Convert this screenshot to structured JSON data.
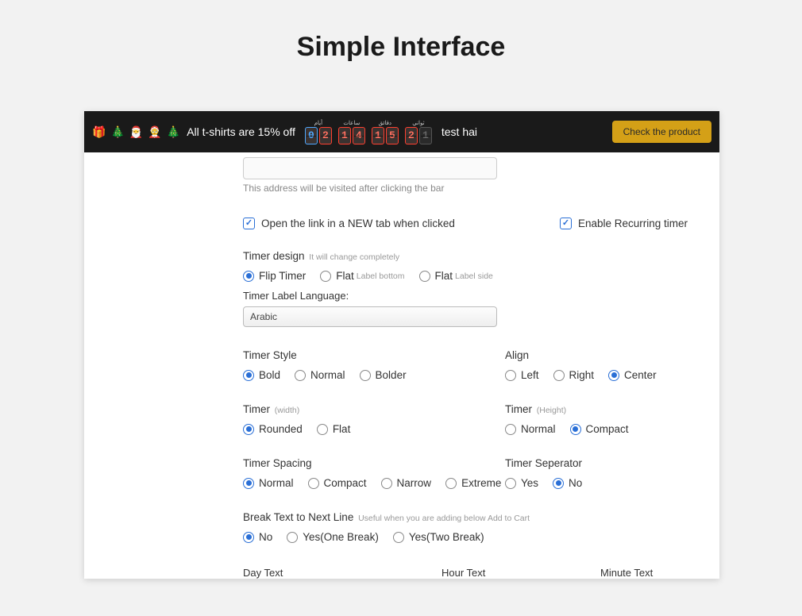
{
  "page": {
    "title": "Simple Interface"
  },
  "topbar": {
    "emojis": [
      "🎁",
      "🎄",
      "🎅",
      "🤶",
      "🎄"
    ],
    "promo_text": "All t-shirts are 15% off",
    "timer": {
      "days_lbl": "أيام",
      "hours_lbl": "ساعات",
      "mins_lbl": "دقائق",
      "secs_lbl": "ثواني",
      "d1": "0",
      "d2": "2",
      "h1": "1",
      "h2": "4",
      "m1": "1",
      "m2": "5",
      "s1": "2",
      "s2": "1"
    },
    "after_text": "test hai",
    "button": "Check the product"
  },
  "form": {
    "address_hint": "This address will be visited after clicking the bar",
    "open_new_tab_label": "Open the link in a NEW tab when clicked",
    "enable_recurring_label": "Enable Recurring timer",
    "timer_design": {
      "label": "Timer design",
      "sub": "It will change completely",
      "opt_flip": "Flip Timer",
      "opt_flat_bottom": "Flat",
      "opt_flat_bottom_sub": "Label bottom",
      "opt_flat_side": "Flat",
      "opt_flat_side_sub": "Label side"
    },
    "lang_label": "Timer Label Language:",
    "lang_value": "Arabic",
    "timer_style": {
      "label": "Timer Style",
      "opt1": "Bold",
      "opt2": "Normal",
      "opt3": "Bolder"
    },
    "align": {
      "label": "Align",
      "opt1": "Left",
      "opt2": "Right",
      "opt3": "Center"
    },
    "timer_width": {
      "label": "Timer",
      "sub": "(width)",
      "opt1": "Rounded",
      "opt2": "Flat"
    },
    "timer_height": {
      "label": "Timer",
      "sub": "(Height)",
      "opt1": "Normal",
      "opt2": "Compact"
    },
    "timer_spacing": {
      "label": "Timer Spacing",
      "opt1": "Normal",
      "opt2": "Compact",
      "opt3": "Narrow",
      "opt4": "Extreme"
    },
    "timer_separator": {
      "label": "Timer Seperator",
      "opt1": "Yes",
      "opt2": "No"
    },
    "break_text": {
      "label": "Break Text to Next Line",
      "sub": "Useful when you are adding below Add to Cart",
      "opt1": "No",
      "opt2": "Yes(One Break)",
      "opt3": "Yes(Two Break)"
    },
    "bottom": {
      "day": "Day Text",
      "hour": "Hour Text",
      "minute": "Minute Text"
    }
  }
}
